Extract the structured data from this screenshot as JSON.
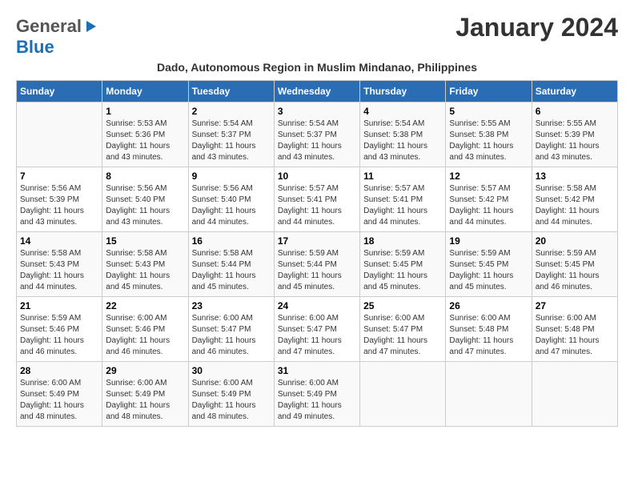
{
  "logo": {
    "general": "General",
    "blue": "Blue"
  },
  "title": "January 2024",
  "subtitle": "Dado, Autonomous Region in Muslim Mindanao, Philippines",
  "days_of_week": [
    "Sunday",
    "Monday",
    "Tuesday",
    "Wednesday",
    "Thursday",
    "Friday",
    "Saturday"
  ],
  "weeks": [
    [
      {
        "day": "",
        "info": ""
      },
      {
        "day": "1",
        "info": "Sunrise: 5:53 AM\nSunset: 5:36 PM\nDaylight: 11 hours and 43 minutes."
      },
      {
        "day": "2",
        "info": "Sunrise: 5:54 AM\nSunset: 5:37 PM\nDaylight: 11 hours and 43 minutes."
      },
      {
        "day": "3",
        "info": "Sunrise: 5:54 AM\nSunset: 5:37 PM\nDaylight: 11 hours and 43 minutes."
      },
      {
        "day": "4",
        "info": "Sunrise: 5:54 AM\nSunset: 5:38 PM\nDaylight: 11 hours and 43 minutes."
      },
      {
        "day": "5",
        "info": "Sunrise: 5:55 AM\nSunset: 5:38 PM\nDaylight: 11 hours and 43 minutes."
      },
      {
        "day": "6",
        "info": "Sunrise: 5:55 AM\nSunset: 5:39 PM\nDaylight: 11 hours and 43 minutes."
      }
    ],
    [
      {
        "day": "7",
        "info": "Sunrise: 5:56 AM\nSunset: 5:39 PM\nDaylight: 11 hours and 43 minutes."
      },
      {
        "day": "8",
        "info": "Sunrise: 5:56 AM\nSunset: 5:40 PM\nDaylight: 11 hours and 43 minutes."
      },
      {
        "day": "9",
        "info": "Sunrise: 5:56 AM\nSunset: 5:40 PM\nDaylight: 11 hours and 44 minutes."
      },
      {
        "day": "10",
        "info": "Sunrise: 5:57 AM\nSunset: 5:41 PM\nDaylight: 11 hours and 44 minutes."
      },
      {
        "day": "11",
        "info": "Sunrise: 5:57 AM\nSunset: 5:41 PM\nDaylight: 11 hours and 44 minutes."
      },
      {
        "day": "12",
        "info": "Sunrise: 5:57 AM\nSunset: 5:42 PM\nDaylight: 11 hours and 44 minutes."
      },
      {
        "day": "13",
        "info": "Sunrise: 5:58 AM\nSunset: 5:42 PM\nDaylight: 11 hours and 44 minutes."
      }
    ],
    [
      {
        "day": "14",
        "info": "Sunrise: 5:58 AM\nSunset: 5:43 PM\nDaylight: 11 hours and 44 minutes."
      },
      {
        "day": "15",
        "info": "Sunrise: 5:58 AM\nSunset: 5:43 PM\nDaylight: 11 hours and 45 minutes."
      },
      {
        "day": "16",
        "info": "Sunrise: 5:58 AM\nSunset: 5:44 PM\nDaylight: 11 hours and 45 minutes."
      },
      {
        "day": "17",
        "info": "Sunrise: 5:59 AM\nSunset: 5:44 PM\nDaylight: 11 hours and 45 minutes."
      },
      {
        "day": "18",
        "info": "Sunrise: 5:59 AM\nSunset: 5:45 PM\nDaylight: 11 hours and 45 minutes."
      },
      {
        "day": "19",
        "info": "Sunrise: 5:59 AM\nSunset: 5:45 PM\nDaylight: 11 hours and 45 minutes."
      },
      {
        "day": "20",
        "info": "Sunrise: 5:59 AM\nSunset: 5:45 PM\nDaylight: 11 hours and 46 minutes."
      }
    ],
    [
      {
        "day": "21",
        "info": "Sunrise: 5:59 AM\nSunset: 5:46 PM\nDaylight: 11 hours and 46 minutes."
      },
      {
        "day": "22",
        "info": "Sunrise: 6:00 AM\nSunset: 5:46 PM\nDaylight: 11 hours and 46 minutes."
      },
      {
        "day": "23",
        "info": "Sunrise: 6:00 AM\nSunset: 5:47 PM\nDaylight: 11 hours and 46 minutes."
      },
      {
        "day": "24",
        "info": "Sunrise: 6:00 AM\nSunset: 5:47 PM\nDaylight: 11 hours and 47 minutes."
      },
      {
        "day": "25",
        "info": "Sunrise: 6:00 AM\nSunset: 5:47 PM\nDaylight: 11 hours and 47 minutes."
      },
      {
        "day": "26",
        "info": "Sunrise: 6:00 AM\nSunset: 5:48 PM\nDaylight: 11 hours and 47 minutes."
      },
      {
        "day": "27",
        "info": "Sunrise: 6:00 AM\nSunset: 5:48 PM\nDaylight: 11 hours and 47 minutes."
      }
    ],
    [
      {
        "day": "28",
        "info": "Sunrise: 6:00 AM\nSunset: 5:49 PM\nDaylight: 11 hours and 48 minutes."
      },
      {
        "day": "29",
        "info": "Sunrise: 6:00 AM\nSunset: 5:49 PM\nDaylight: 11 hours and 48 minutes."
      },
      {
        "day": "30",
        "info": "Sunrise: 6:00 AM\nSunset: 5:49 PM\nDaylight: 11 hours and 48 minutes."
      },
      {
        "day": "31",
        "info": "Sunrise: 6:00 AM\nSunset: 5:49 PM\nDaylight: 11 hours and 49 minutes."
      },
      {
        "day": "",
        "info": ""
      },
      {
        "day": "",
        "info": ""
      },
      {
        "day": "",
        "info": ""
      }
    ]
  ]
}
